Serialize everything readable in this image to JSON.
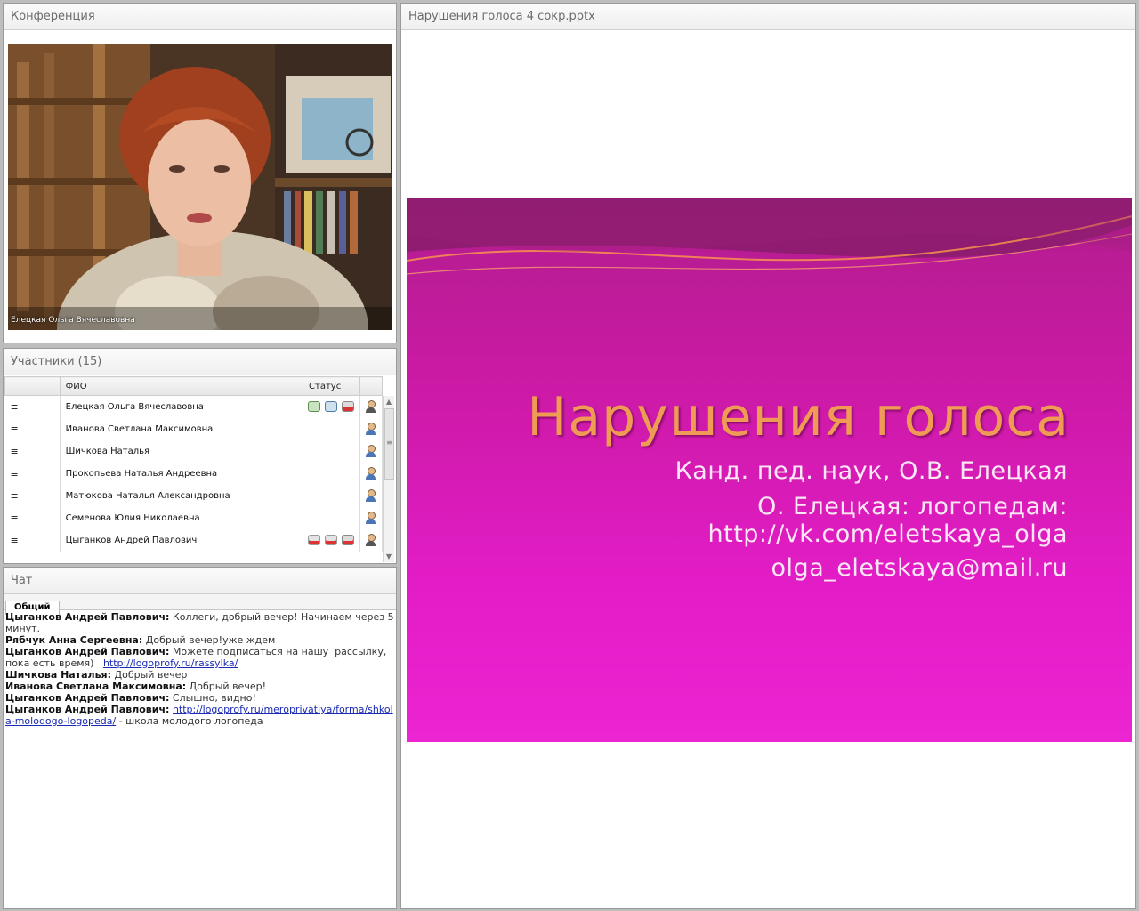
{
  "conference": {
    "title": "Конференция",
    "speaker_caption": "Елецкая Ольга Вячеславовна"
  },
  "participants": {
    "title": "Участники (15)",
    "columns": {
      "name": "ФИО",
      "status": "Статус"
    },
    "rows": [
      {
        "name": "Елецкая  Ольга  Вячеславовна",
        "status_icons": [
          "webcam-icon",
          "microphone-icon",
          "screen-share-off-icon"
        ],
        "role": "host"
      },
      {
        "name": "Иванова  Светлана   Максимовна",
        "status_icons": [],
        "role": "participant"
      },
      {
        "name": "Шичкова  Наталья",
        "status_icons": [],
        "role": "participant"
      },
      {
        "name": "Прокопьева  Наталья   Андреевна",
        "status_icons": [],
        "role": "participant"
      },
      {
        "name": "Матюкова  Наталья  Александровна",
        "status_icons": [],
        "role": "participant"
      },
      {
        "name": "Семенова   Юлия   Николаевна",
        "status_icons": [],
        "role": "participant"
      },
      {
        "name": "Цыганков  Андрей   Павлович",
        "status_icons": [
          "webcam-off-icon",
          "microphone-off-icon",
          "screen-share-off-icon"
        ],
        "role": "host"
      }
    ]
  },
  "chat": {
    "title": "Чат",
    "tab": "Общий",
    "messages": [
      {
        "author": "Цыганков Андрей   Павлович:",
        "text": " Коллеги, добрый вечер! Начинаем через 5 минут.",
        "link": "",
        "after": ""
      },
      {
        "author": "Рябчук  Анна  Сергеевна:",
        "text": " Добрый вечер!уже ждем",
        "link": "",
        "after": ""
      },
      {
        "author": "Цыганков Андрей   Павлович:",
        "text": " Можете подписаться на нашу  рассылку, пока есть время)   ",
        "link": "http://logoprofy.ru/rassylka/",
        "after": ""
      },
      {
        "author": "Шичкова Наталья:",
        "text": " Добрый вечер",
        "link": "",
        "after": ""
      },
      {
        "author": "Иванова Светлана  Максимовна:",
        "text": " Добрый вечер!",
        "link": "",
        "after": ""
      },
      {
        "author": "Цыганков Андрей   Павлович:",
        "text": " Слышно, видно!",
        "link": "",
        "after": ""
      },
      {
        "author": "Цыганков Андрей   Павлович:",
        "text": " ",
        "link": "http://logoprofy.ru/meroprivatiya/forma/shkola-molodogo-logopeda/",
        "after": " - школа молодого логопеда"
      }
    ]
  },
  "presentation": {
    "title": "Нарушения голоса 4 сокр.pptx",
    "slide": {
      "title": "Нарушения голоса",
      "lines": [
        "Канд. пед. наук, О.В. Елецкая",
        "О. Елецкая: логопедам:",
        "http://vk.com/eletskaya_olga",
        "olga_eletskaya@mail.ru"
      ]
    }
  }
}
